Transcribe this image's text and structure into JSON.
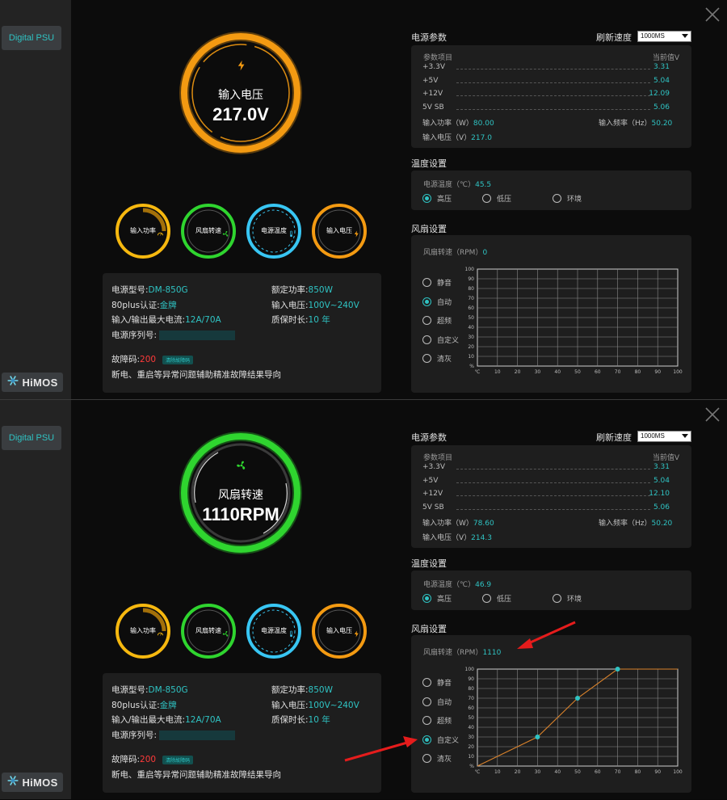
{
  "app": {
    "sidebar_tab": "Digital PSU",
    "brand": "HiMOS",
    "accent": "#2fc3c3"
  },
  "panes": [
    {
      "main_gauge": {
        "title": "输入电压",
        "value": "217.0V",
        "icon": "lightning-icon",
        "color": "#f39a12"
      },
      "mini_gauges": [
        {
          "label": "输入功率",
          "icon": "gauge-icon",
          "color": "#f6b80f"
        },
        {
          "label": "风扇转速",
          "icon": "fan-icon",
          "color": "#2fd52f"
        },
        {
          "label": "电源温度",
          "icon": "thermometer-icon",
          "color": "#38c6f3"
        },
        {
          "label": "输入电压",
          "icon": "lightning-icon",
          "color": "#f39a12"
        }
      ],
      "info": {
        "model_label": "电源型号:",
        "model": "DM-850G",
        "rated_label": "额定功率:",
        "rated": "850W",
        "cert_label": "80plus认证:",
        "cert": "金牌",
        "vin_label": "输入电压:",
        "vin": "100V~240V",
        "current_label": "输入/输出最大电流:",
        "current": "12A/70A",
        "warranty_label": "质保时长:",
        "warranty": "10 年",
        "serial_label": "电源序列号:",
        "fault_label": "故障码:",
        "fault": "200",
        "clear_label": "清除故障码",
        "note": "断电、重启等异常问题辅助精准故障结果导向"
      },
      "params": {
        "title": "电源参数",
        "rate_label": "刷新速度",
        "rate_value": "1000MS",
        "col_item": "参数项目",
        "col_value": "当前值V",
        "rows": [
          {
            "label": "+3.3V",
            "value": "3.31"
          },
          {
            "label": "+5V",
            "value": "5.04"
          },
          {
            "label": "+12V",
            "value": "12.09"
          },
          {
            "label": "5V SB",
            "value": "5.06"
          }
        ],
        "power_label": "输入功率（W）",
        "power": "80.00",
        "freq_label": "输入频率（Hz）",
        "freq": "50.20",
        "voltage_label": "输入电压（V）",
        "voltage": "217.0"
      },
      "temp": {
        "title": "温度设置",
        "label": "电源温度（℃）",
        "value": "45.5",
        "options": [
          "高压",
          "低压",
          "环境"
        ],
        "selected": 0
      },
      "fan": {
        "title": "风扇设置",
        "speed_label": "风扇转速（RPM）",
        "speed": "0",
        "modes": [
          "静音",
          "自动",
          "超频",
          "自定义",
          "清灰"
        ],
        "selected": 1
      },
      "chart_data": {
        "type": "line",
        "x_ticks": [
          "℃",
          "10",
          "20",
          "30",
          "40",
          "50",
          "60",
          "70",
          "80",
          "90",
          "100"
        ],
        "y_ticks": [
          "%",
          "10",
          "20",
          "30",
          "40",
          "50",
          "60",
          "70",
          "80",
          "90",
          "100"
        ],
        "xlim": [
          0,
          100
        ],
        "ylim": [
          0,
          100
        ],
        "grid": true,
        "series": []
      }
    },
    {
      "main_gauge": {
        "title": "风扇转速",
        "value": "1110RPM",
        "icon": "fan-icon",
        "color": "#2fd52f"
      },
      "mini_gauges": [
        {
          "label": "输入功率",
          "icon": "gauge-icon",
          "color": "#f6b80f"
        },
        {
          "label": "风扇转速",
          "icon": "fan-icon",
          "color": "#2fd52f"
        },
        {
          "label": "电源温度",
          "icon": "thermometer-icon",
          "color": "#38c6f3"
        },
        {
          "label": "输入电压",
          "icon": "lightning-icon",
          "color": "#f39a12"
        }
      ],
      "info": {
        "model_label": "电源型号:",
        "model": "DM-850G",
        "rated_label": "额定功率:",
        "rated": "850W",
        "cert_label": "80plus认证:",
        "cert": "金牌",
        "vin_label": "输入电压:",
        "vin": "100V~240V",
        "current_label": "输入/输出最大电流:",
        "current": "12A/70A",
        "warranty_label": "质保时长:",
        "warranty": "10 年",
        "serial_label": "电源序列号:",
        "fault_label": "故障码:",
        "fault": "200",
        "clear_label": "清除故障码",
        "note": "断电、重启等异常问题辅助精准故障结果导向"
      },
      "params": {
        "title": "电源参数",
        "rate_label": "刷新速度",
        "rate_value": "1000MS",
        "col_item": "参数项目",
        "col_value": "当前值V",
        "rows": [
          {
            "label": "+3.3V",
            "value": "3.31"
          },
          {
            "label": "+5V",
            "value": "5.04"
          },
          {
            "label": "+12V",
            "value": "12.10"
          },
          {
            "label": "5V SB",
            "value": "5.06"
          }
        ],
        "power_label": "输入功率（W）",
        "power": "78.60",
        "freq_label": "输入频率（Hz）",
        "freq": "50.20",
        "voltage_label": "输入电压（V）",
        "voltage": "214.3"
      },
      "temp": {
        "title": "温度设置",
        "label": "电源温度（℃）",
        "value": "46.9",
        "options": [
          "高压",
          "低压",
          "环境"
        ],
        "selected": 0
      },
      "fan": {
        "title": "风扇设置",
        "speed_label": "风扇转速（RPM）",
        "speed": "1110",
        "modes": [
          "静音",
          "自动",
          "超频",
          "自定义",
          "清灰"
        ],
        "selected": 3
      },
      "chart_data": {
        "type": "line",
        "x_ticks": [
          "℃",
          "10",
          "20",
          "30",
          "40",
          "50",
          "60",
          "70",
          "80",
          "90",
          "100"
        ],
        "y_ticks": [
          "%",
          "10",
          "20",
          "30",
          "40",
          "50",
          "60",
          "70",
          "80",
          "90",
          "100"
        ],
        "xlim": [
          0,
          100
        ],
        "ylim": [
          0,
          100
        ],
        "grid": true,
        "series": [
          {
            "x": [
              0,
              30,
              50,
              70,
              100
            ],
            "y": [
              0,
              30,
              70,
              100,
              100
            ],
            "markers_at": [
              30,
              50,
              70
            ],
            "color": "#d9822b"
          }
        ]
      }
    }
  ]
}
